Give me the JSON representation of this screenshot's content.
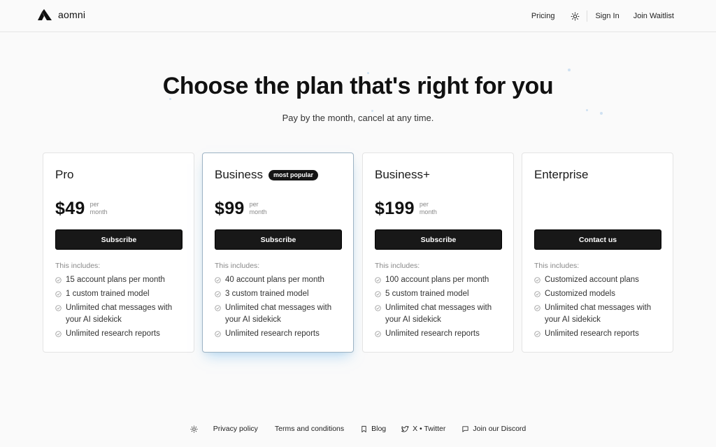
{
  "brand": {
    "name": "aomni"
  },
  "nav": {
    "pricing": "Pricing",
    "sign_in": "Sign In",
    "join": "Join Waitlist",
    "theme_icon": "sun-icon"
  },
  "hero": {
    "title": "Choose the plan that's right for you",
    "subtitle": "Pay by the month, cancel at any time."
  },
  "plans": [
    {
      "name": "Pro",
      "price": "$49",
      "per_1": "per",
      "per_2": "month",
      "button": "Subscribe",
      "includes": "This includes:",
      "features": [
        "15 account plans per month",
        "1 custom trained model",
        "Unlimited chat messages with your AI sidekick",
        "Unlimited research reports"
      ]
    },
    {
      "name": "Business",
      "badge": "most popular",
      "price": "$99",
      "per_1": "per",
      "per_2": "month",
      "button": "Subscribe",
      "includes": "This includes:",
      "features": [
        "40 account plans per month",
        "3 custom trained model",
        "Unlimited chat messages with your AI sidekick",
        "Unlimited research reports"
      ]
    },
    {
      "name": "Business+",
      "price": "$199",
      "per_1": "per",
      "per_2": "month",
      "button": "Subscribe",
      "includes": "This includes:",
      "features": [
        "100 account plans per month",
        "5 custom trained model",
        "Unlimited chat messages with your AI sidekick",
        "Unlimited research reports"
      ]
    },
    {
      "name": "Enterprise",
      "button": "Contact us",
      "includes": "This includes:",
      "features": [
        "Customized account plans",
        "Customized models",
        "Unlimited chat messages with your AI sidekick",
        "Unlimited research reports"
      ]
    }
  ],
  "footer": {
    "privacy": "Privacy policy",
    "terms": "Terms and conditions",
    "blog": "Blog",
    "twitter": "X • Twitter",
    "discord": "Join our Discord"
  },
  "colors": {
    "background": "#fafafa",
    "button": "#181818",
    "featured_border": "#9db3c4",
    "featured_glow": "#78bef0"
  }
}
